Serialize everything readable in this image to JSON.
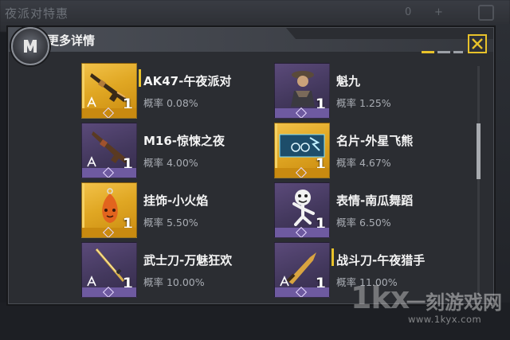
{
  "background": {
    "title": "夜派对特惠",
    "stats": [
      "0",
      "+"
    ]
  },
  "dialog": {
    "title": "更多详情",
    "accent_color": "#e8c22a"
  },
  "items": [
    {
      "name": "AK47-午夜派对",
      "rate": "概率 0.08%",
      "quantity": "1",
      "rarity": "gold",
      "icon": "rifle-icon"
    },
    {
      "name": "魁九",
      "rate": "概率 1.25%",
      "quantity": "1",
      "rarity": "purple",
      "icon": "character-icon"
    },
    {
      "name": "M16-惊悚之夜",
      "rate": "概率 4.00%",
      "quantity": "1",
      "rarity": "purple",
      "icon": "rifle-icon"
    },
    {
      "name": "名片-外星飞熊",
      "rate": "概率 4.67%",
      "quantity": "1",
      "rarity": "gold",
      "icon": "card-icon"
    },
    {
      "name": "挂饰-小火焰",
      "rate": "概率 5.50%",
      "quantity": "1",
      "rarity": "gold",
      "icon": "charm-icon"
    },
    {
      "name": "表情-南瓜舞蹈",
      "rate": "概率 6.50%",
      "quantity": "1",
      "rarity": "purple",
      "icon": "emote-icon"
    },
    {
      "name": "武士刀-万魅狂欢",
      "rate": "概率 10.00%",
      "quantity": "1",
      "rarity": "purple",
      "icon": "katana-icon"
    },
    {
      "name": "战斗刀-午夜猎手",
      "rate": "概率 11.00%",
      "quantity": "1",
      "rarity": "purple",
      "icon": "knife-icon"
    }
  ],
  "watermark": {
    "logo": "1kx",
    "text": "一刻游戏网",
    "url": "www.1kyx.com"
  }
}
